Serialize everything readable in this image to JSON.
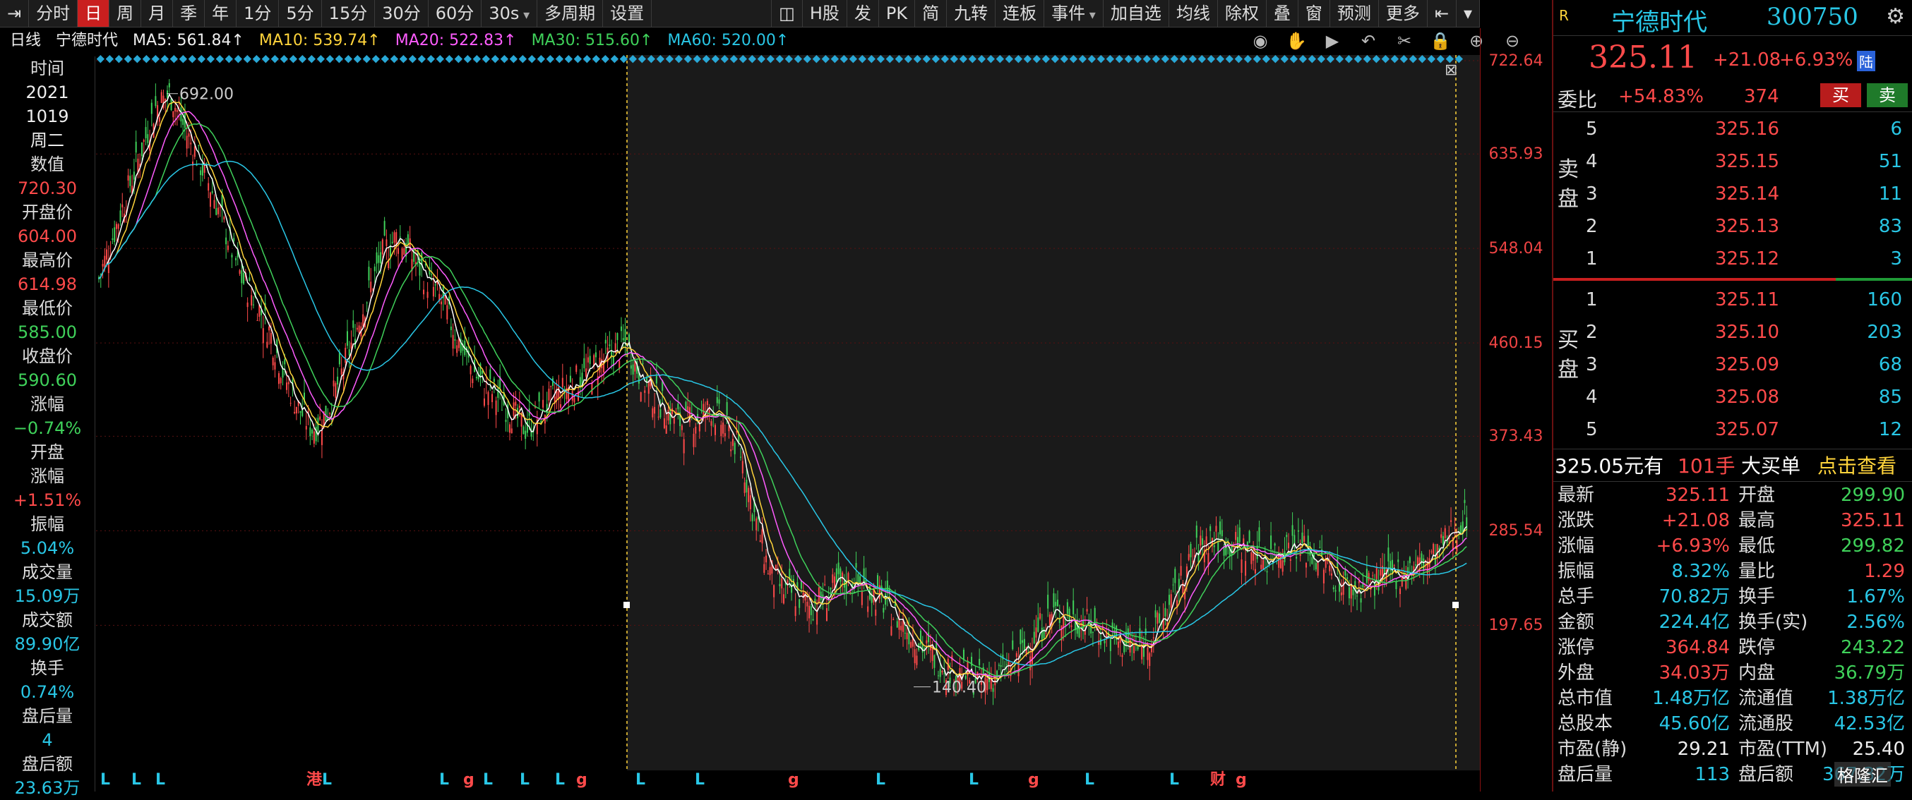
{
  "toolbar": {
    "left": [
      "分时",
      "日",
      "周",
      "月",
      "季",
      "年",
      "1分",
      "5分",
      "15分",
      "30分",
      "60分",
      "30s",
      "多周期",
      "设置"
    ],
    "active": "日",
    "right": [
      "H股",
      "发",
      "PK",
      "简",
      "九转",
      "连板",
      "事件",
      "加自选",
      "均线",
      "除权",
      "叠",
      "窗",
      "预测",
      "更多"
    ]
  },
  "indicators": {
    "period": "日线",
    "name": "宁德时代",
    "ma5": "MA5: 561.84↑",
    "ma10": "MA10: 539.74↑",
    "ma20": "MA20: 522.83↑",
    "ma30": "MA30: 515.60↑",
    "ma60": "MA60: 520.00↑"
  },
  "crosshair": [
    {
      "label": "时间",
      "value": "2021"
    },
    {
      "label": "",
      "value": "1019"
    },
    {
      "label": "",
      "value": "周二"
    },
    {
      "label": "数值",
      "value": "720.30"
    },
    {
      "label": "开盘价",
      "value": "604.00"
    },
    {
      "label": "最高价",
      "value": "614.98"
    },
    {
      "label": "最低价",
      "value": "585.00"
    },
    {
      "label": "收盘价",
      "value": "590.60"
    },
    {
      "label": "涨幅",
      "value": "−0.74%"
    },
    {
      "label": "开盘",
      "value": ""
    },
    {
      "label": "涨幅",
      "value": "+1.51%"
    },
    {
      "label": "振幅",
      "value": "5.04%"
    },
    {
      "label": "成交量",
      "value": "15.09万"
    },
    {
      "label": "成交额",
      "value": "89.90亿"
    },
    {
      "label": "换手",
      "value": "0.74%"
    },
    {
      "label": "盘后量",
      "value": "4"
    },
    {
      "label": "盘后额",
      "value": "23.63万"
    }
  ],
  "chart_data": {
    "type": "candlestick",
    "ytick_labels": [
      "722.64",
      "635.93",
      "548.04",
      "460.15",
      "373.43",
      "285.54",
      "197.65"
    ],
    "ylim": [
      110,
      722.64
    ],
    "annotations": {
      "high_label": "692.00",
      "low_label": "140.40"
    },
    "bottom_markers": [
      "L",
      "L",
      "L",
      "港",
      "L",
      "L",
      "g",
      "L",
      "L",
      "L",
      "g",
      "L",
      "L",
      "g",
      "L",
      "L",
      "g",
      "L",
      "L",
      "财",
      "g"
    ],
    "close_path": [
      520,
      560,
      600,
      640,
      680,
      692,
      660,
      630,
      600,
      560,
      520,
      500,
      470,
      430,
      400,
      380,
      395,
      430,
      470,
      510,
      545,
      560,
      540,
      520,
      500,
      470,
      440,
      420,
      410,
      395,
      380,
      395,
      410,
      420,
      430,
      440,
      450,
      460,
      430,
      410,
      395,
      385,
      390,
      400,
      380,
      360,
      300,
      250,
      230,
      225,
      215,
      225,
      235,
      240,
      230,
      220,
      205,
      190,
      175,
      165,
      155,
      150,
      145,
      150,
      160,
      175,
      195,
      210,
      205,
      200,
      195,
      185,
      180,
      175,
      190,
      210,
      240,
      265,
      280,
      275,
      270,
      265,
      260,
      270,
      275,
      265,
      255,
      240,
      230,
      235,
      240,
      245,
      250,
      255,
      265,
      285,
      300
    ]
  },
  "quote": {
    "badge": "R",
    "name": "宁德时代",
    "code": "300750",
    "price": "325.11",
    "change": "+21.08",
    "pct": "+6.93%",
    "tag": "陆",
    "weibi_label": "委比",
    "weibi": "+54.83%",
    "weicha": "374",
    "buy_btn": "买",
    "sell_btn": "卖",
    "sell_label": "卖盘",
    "buy_label": "买盘",
    "asks": [
      {
        "lv": "5",
        "price": "325.16",
        "qty": "6"
      },
      {
        "lv": "4",
        "price": "325.15",
        "qty": "51"
      },
      {
        "lv": "3",
        "price": "325.14",
        "qty": "11"
      },
      {
        "lv": "2",
        "price": "325.13",
        "qty": "83"
      },
      {
        "lv": "1",
        "price": "325.12",
        "qty": "3"
      }
    ],
    "bids": [
      {
        "lv": "1",
        "price": "325.11",
        "qty": "160"
      },
      {
        "lv": "2",
        "price": "325.10",
        "qty": "203"
      },
      {
        "lv": "3",
        "price": "325.09",
        "qty": "68"
      },
      {
        "lv": "4",
        "price": "325.08",
        "qty": "85"
      },
      {
        "lv": "5",
        "price": "325.07",
        "qty": "12"
      }
    ],
    "big_order": {
      "price": "325.05元有",
      "qty": "101手",
      "label": "大买单",
      "link": "点击查看"
    },
    "stats": [
      {
        "k1": "最新",
        "v1": "325.11",
        "c1": "red",
        "k2": "开盘",
        "v2": "299.90",
        "c2": "grn"
      },
      {
        "k1": "涨跌",
        "v1": "+21.08",
        "c1": "red",
        "k2": "最高",
        "v2": "325.11",
        "c2": "red"
      },
      {
        "k1": "涨幅",
        "v1": "+6.93%",
        "c1": "red",
        "k2": "最低",
        "v2": "299.82",
        "c2": "grn"
      },
      {
        "k1": "振幅",
        "v1": "8.32%",
        "c1": "cyan",
        "k2": "量比",
        "v2": "1.29",
        "c2": "red"
      },
      {
        "k1": "总手",
        "v1": "70.82万",
        "c1": "cyan",
        "k2": "换手",
        "v2": "1.67%",
        "c2": "cyan"
      },
      {
        "k1": "金额",
        "v1": "224.4亿",
        "c1": "cyan",
        "k2": "换手(实)",
        "v2": "2.56%",
        "c2": "cyan"
      },
      {
        "k1": "涨停",
        "v1": "364.84",
        "c1": "red",
        "k2": "跌停",
        "v2": "243.22",
        "c2": "grn"
      },
      {
        "k1": "外盘",
        "v1": "34.03万",
        "c1": "red",
        "k2": "内盘",
        "v2": "36.79万",
        "c2": "grn"
      },
      {
        "k1": "总市值",
        "v1": "1.48万亿",
        "c1": "cyan",
        "k2": "流通值",
        "v2": "1.38万亿",
        "c2": "cyan"
      },
      {
        "k1": "总股本",
        "v1": "45.60亿",
        "c1": "cyan",
        "k2": "流通股",
        "v2": "42.53亿",
        "c2": "cyan"
      },
      {
        "k1": "市盈(静)",
        "v1": "29.21",
        "c1": "wht",
        "k2": "市盈(TTM)",
        "v2": "25.40",
        "c2": "wht"
      },
      {
        "k1": "盘后量",
        "v1": "113",
        "c1": "cyan",
        "k2": "盘后额",
        "v2": "367.32万",
        "c2": "cyan"
      }
    ],
    "watermark": "格隆汇"
  },
  "colors": {
    "up": "#ff4a4a",
    "down": "#3fd15a",
    "ma5": "#ffffff",
    "ma10": "#ffd43b",
    "ma20": "#ff5cff",
    "ma30": "#3fd15a",
    "ma60": "#29c7e6"
  }
}
